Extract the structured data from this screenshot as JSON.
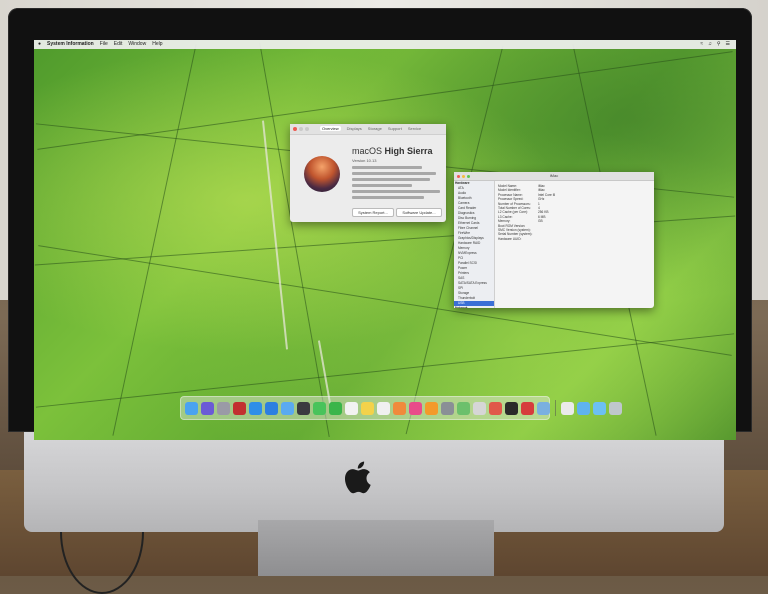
{
  "menubar": {
    "app_name": "System Information",
    "items": [
      "File",
      "Edit",
      "Window",
      "Help"
    ]
  },
  "about_window": {
    "tabs": [
      "Overview",
      "Displays",
      "Storage",
      "Support",
      "Service"
    ],
    "os_name_light": "macOS ",
    "os_name_bold": "High Sierra",
    "version": "Version 10.13",
    "buttons": [
      "System Report...",
      "Software Update..."
    ]
  },
  "sysinfo_window": {
    "title": "iMac",
    "sidebar": [
      {
        "label": "Hardware",
        "head": true
      },
      {
        "label": "ATA"
      },
      {
        "label": "Audio"
      },
      {
        "label": "Bluetooth"
      },
      {
        "label": "Camera"
      },
      {
        "label": "Card Reader"
      },
      {
        "label": "Diagnostics"
      },
      {
        "label": "Disc Burning"
      },
      {
        "label": "Ethernet Cards"
      },
      {
        "label": "Fibre Channel"
      },
      {
        "label": "FireWire"
      },
      {
        "label": "Graphics/Displays"
      },
      {
        "label": "Hardware RAID"
      },
      {
        "label": "Memory"
      },
      {
        "label": "NVMExpress"
      },
      {
        "label": "PCI"
      },
      {
        "label": "Parallel SCSI"
      },
      {
        "label": "Power"
      },
      {
        "label": "Printers"
      },
      {
        "label": "SAS"
      },
      {
        "label": "SATA/SATA Express"
      },
      {
        "label": "SPI"
      },
      {
        "label": "Storage"
      },
      {
        "label": "Thunderbolt"
      },
      {
        "label": "USB",
        "selected": true
      },
      {
        "label": "Network",
        "head": true
      },
      {
        "label": "Firewall"
      },
      {
        "label": "Locations"
      },
      {
        "label": "Volumes"
      }
    ],
    "fields": [
      {
        "k": "Model Name:",
        "v": "iMac"
      },
      {
        "k": "Model Identifier:",
        "v": "iMac"
      },
      {
        "k": "Processor Name:",
        "v": "Intel Core i5"
      },
      {
        "k": "Processor Speed:",
        "v": "GHz"
      },
      {
        "k": "Number of Processors:",
        "v": "1"
      },
      {
        "k": "Total Number of Cores:",
        "v": "4"
      },
      {
        "k": "L2 Cache (per Core):",
        "v": "256 KB"
      },
      {
        "k": "L3 Cache:",
        "v": "6 MB"
      },
      {
        "k": "Memory:",
        "v": "GB"
      },
      {
        "k": "Boot ROM Version:",
        "v": ""
      },
      {
        "k": "SMC Version (system):",
        "v": ""
      },
      {
        "k": "Serial Number (system):",
        "v": ""
      },
      {
        "k": "Hardware UUID:",
        "v": ""
      }
    ]
  },
  "dock": {
    "icons": [
      {
        "name": "finder-icon",
        "color": "#4aa3f0"
      },
      {
        "name": "siri-icon",
        "color": "#6b5bd6"
      },
      {
        "name": "launchpad-icon",
        "color": "#9a9aa6"
      },
      {
        "name": "photo-booth-icon",
        "color": "#c23030"
      },
      {
        "name": "safari-icon",
        "color": "#2f8ee8"
      },
      {
        "name": "app-store-icon",
        "color": "#2d7fe0"
      },
      {
        "name": "mail-icon",
        "color": "#5aaaf0"
      },
      {
        "name": "quicktime-icon",
        "color": "#3a3a40"
      },
      {
        "name": "messages-icon",
        "color": "#49c35b"
      },
      {
        "name": "facetime-icon",
        "color": "#3bb54a"
      },
      {
        "name": "calendar-icon",
        "color": "#f2f2f2"
      },
      {
        "name": "notes-icon",
        "color": "#f3d24a"
      },
      {
        "name": "reminders-icon",
        "color": "#f0f0f0"
      },
      {
        "name": "photos-icon",
        "color": "#f08a3c"
      },
      {
        "name": "itunes-icon",
        "color": "#e84b8a"
      },
      {
        "name": "ibooks-icon",
        "color": "#f39a2a"
      },
      {
        "name": "system-preferences-icon",
        "color": "#8a8f96"
      },
      {
        "name": "maps-icon",
        "color": "#6cc06c"
      },
      {
        "name": "photo-app-icon",
        "color": "#d6d6d6"
      },
      {
        "name": "chess-icon",
        "color": "#e0584a"
      },
      {
        "name": "terminal-icon",
        "color": "#2a2a2a"
      },
      {
        "name": "game-icon",
        "color": "#d63c3c"
      },
      {
        "name": "utility-icon",
        "color": "#7ab0e0"
      }
    ],
    "right_icons": [
      {
        "name": "document-icon",
        "color": "#eaeaea"
      },
      {
        "name": "downloads-folder-icon",
        "color": "#5fb3ee"
      },
      {
        "name": "applications-folder-icon",
        "color": "#6cc0f2"
      },
      {
        "name": "trash-icon",
        "color": "#bfc7cc"
      }
    ]
  }
}
